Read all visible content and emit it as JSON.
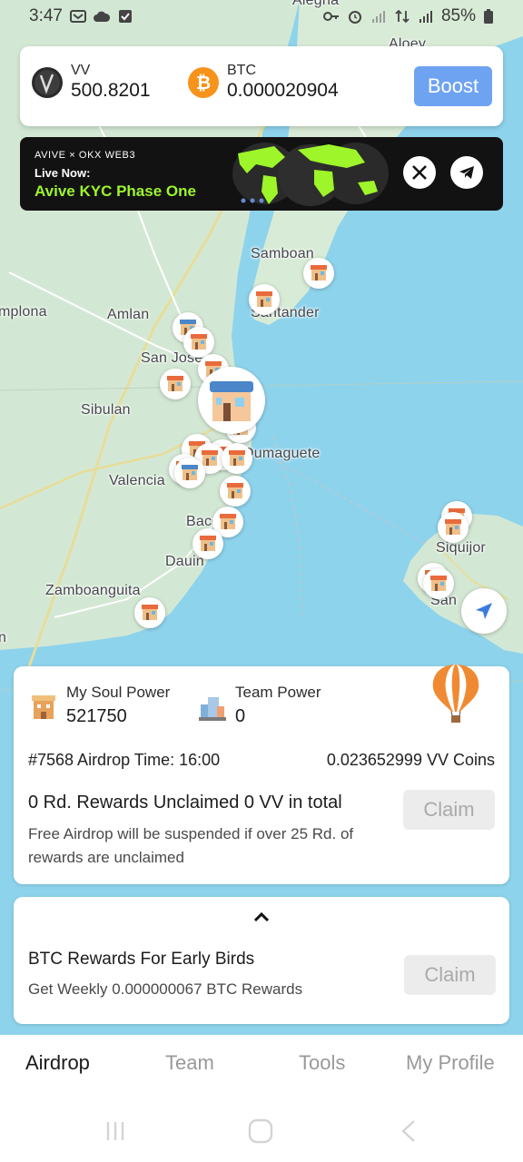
{
  "status_bar": {
    "time": "3:47",
    "battery": "85%",
    "icons_left": [
      "notification-icon",
      "cloud-icon",
      "check-icon"
    ],
    "icons_right": [
      "key-icon",
      "alarm-icon",
      "signal-icon",
      "data-icon",
      "signal-icon",
      "battery-icon"
    ]
  },
  "map": {
    "places": [
      "Aloey",
      "Alegria",
      "Samboan",
      "Santander",
      "Amlan",
      "San Jose",
      "Sibulan",
      "Dumaguete",
      "Valencia",
      "Bacong",
      "Dauin",
      "Zamboanguita",
      "Siquijor",
      "San",
      "mplona",
      "n"
    ]
  },
  "wallet": {
    "vv_label": "VV",
    "vv_value": "500.8201",
    "btc_label": "BTC",
    "btc_value": "0.000020904",
    "boost_label": "Boost",
    "btc_color": "#f7931a",
    "boost_color": "#6ea3f2"
  },
  "banner": {
    "brand": "AVIVE × OKX WEB3",
    "live": "Live Now:",
    "title": "Avive KYC Phase One",
    "title_color": "#9df52a",
    "social": [
      "x-icon",
      "telegram-icon"
    ]
  },
  "power": {
    "soul_label": "My Soul Power",
    "soul_value": "521750",
    "team_label": "Team Power",
    "team_value": "0",
    "airdrop_time": "#7568 Airdrop Time: 16:00",
    "airdrop_coins": "0.023652999 VV Coins",
    "unclaimed": "0 Rd. Rewards Unclaimed 0 VV in total",
    "warning": "Free Airdrop will be suspended if over 25 Rd. of rewards are unclaimed",
    "claim_label": "Claim"
  },
  "btc_rewards": {
    "title": "BTC Rewards For Early Birds",
    "subtitle": "Get Weekly 0.000000067 BTC Rewards",
    "claim_label": "Claim"
  },
  "nav": {
    "tabs": [
      "Airdrop",
      "Team",
      "Tools",
      "My Profile"
    ],
    "active": "Airdrop"
  }
}
